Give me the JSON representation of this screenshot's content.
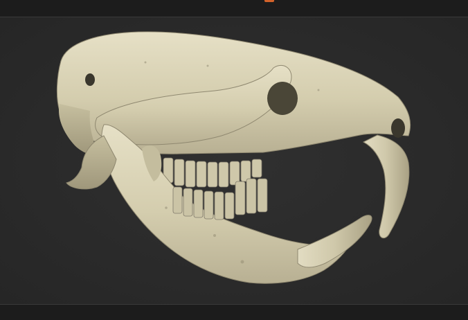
{
  "viewer": {
    "background_color": "#2b2b2b",
    "model_color": "#d9d3b6",
    "accent_color": "#d2622a",
    "model_icon": "rodent-skull-3d-model"
  }
}
